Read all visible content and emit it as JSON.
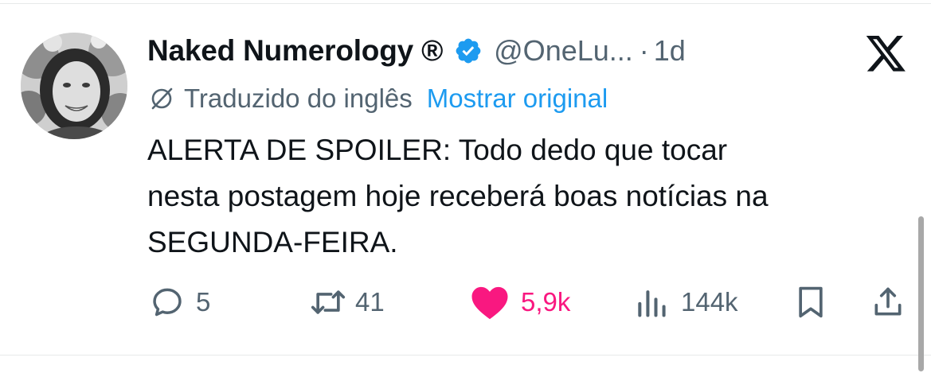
{
  "author": {
    "display_name": "Naked Numerology ®",
    "handle": "@OneLu...",
    "separator": "·",
    "timestamp": "1d",
    "verified": true
  },
  "translation": {
    "label": "Traduzido do inglês",
    "show_original": "Mostrar original"
  },
  "tweet": {
    "lines": [
      "ALERTA DE SPOILER: Todo dedo que tocar",
      "nesta postagem hoje receberá boas notícias na",
      "SEGUNDA-FEIRA."
    ]
  },
  "actions": {
    "replies": "5",
    "reposts": "41",
    "likes": "5,9k",
    "views": "144k"
  },
  "colors": {
    "text_primary": "#0f1419",
    "text_secondary": "#536471",
    "link": "#1d9bf0",
    "like": "#f91880",
    "verified": "#1d9bf0"
  },
  "icons": {
    "close": "x-logo-icon",
    "translate": "translate-icon",
    "reply": "reply-icon",
    "repost": "repost-icon",
    "like": "heart-icon",
    "views": "views-icon",
    "bookmark": "bookmark-icon",
    "share": "share-icon"
  }
}
